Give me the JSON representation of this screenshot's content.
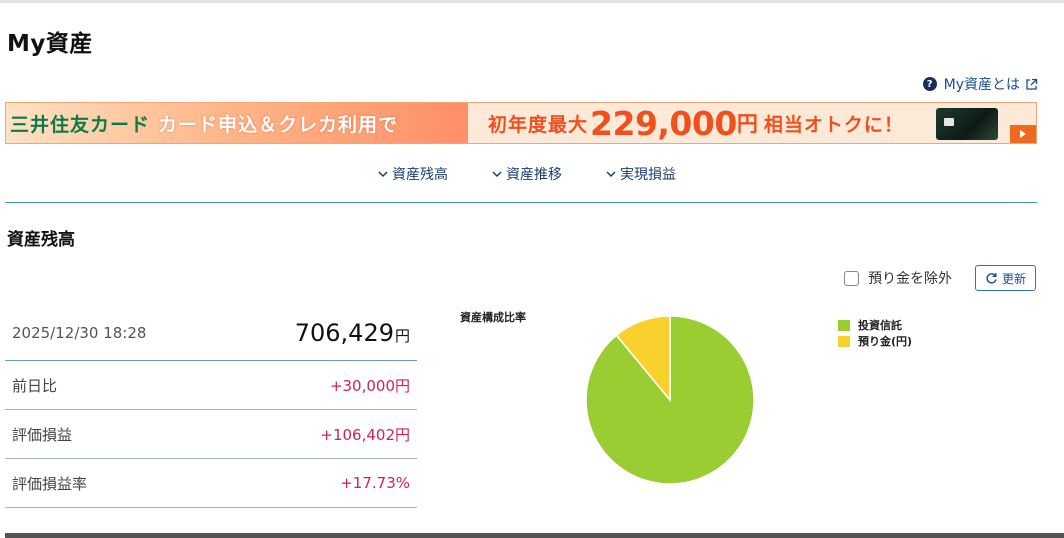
{
  "page": {
    "title": "My資産"
  },
  "help": {
    "label": "My資産とは"
  },
  "banner": {
    "brand": "三井住友カード",
    "campaign": "カード申込＆クレカ利用で",
    "prefix": "初年度最大",
    "amount": "229,000",
    "unit": "円",
    "suffix": "相当オトクに！"
  },
  "anchor_nav": [
    {
      "label": "資産残高"
    },
    {
      "label": "資産推移"
    },
    {
      "label": "実現損益"
    }
  ],
  "balance": {
    "section_title": "資産残高",
    "exclude_label": "預り金を除外",
    "refresh_label": "更新",
    "timestamp": "2025/12/30 18:28",
    "total": "706,429",
    "total_unit": "円",
    "rows": [
      {
        "label": "前日比",
        "value": "+30,000円"
      },
      {
        "label": "評価損益",
        "value": "+106,402円"
      },
      {
        "label": "評価損益率",
        "value": "+17.73%"
      }
    ]
  },
  "colors": {
    "fund": "#9acd32",
    "deposit": "#f8d12f",
    "positive": "#d41f5c",
    "accent": "#2f6fc0"
  },
  "chart_data": {
    "type": "pie",
    "title": "資産構成比率",
    "legend_position": "right",
    "slices": [
      {
        "name": "投資信託",
        "value": 89,
        "color": "#9acd32"
      },
      {
        "name": "預り金(円)",
        "value": 11,
        "color": "#f8d12f"
      }
    ]
  }
}
